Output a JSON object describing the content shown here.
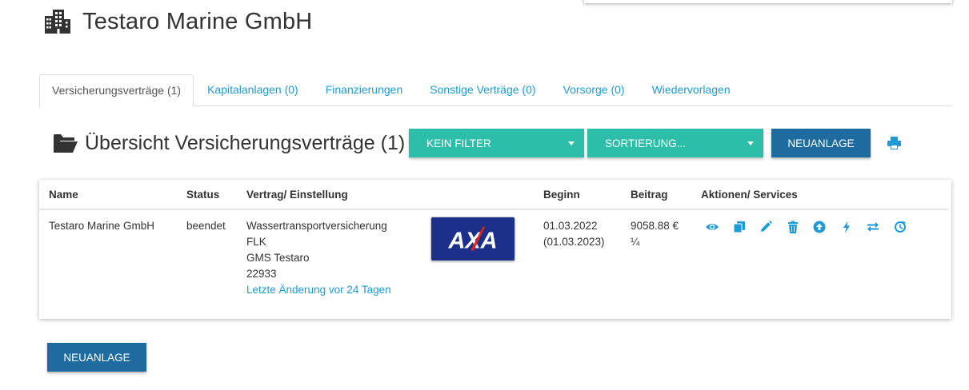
{
  "company_name": "Testaro Marine GmbH",
  "tabs": [
    {
      "label": "Versicherungsverträge (1)",
      "active": true
    },
    {
      "label": "Kapitalanlagen (0)"
    },
    {
      "label": "Finanzierungen"
    },
    {
      "label": "Sonstige Verträge (0)"
    },
    {
      "label": "Vorsorge (0)"
    },
    {
      "label": "Wiedervorlagen"
    }
  ],
  "section_title": "Übersicht Versicherungsverträge (1)",
  "toolbar": {
    "filter_label": "KEIN FILTER",
    "sort_label": "SORTIERUNG...",
    "new_label": "NEUANLAGE"
  },
  "table": {
    "headers": [
      "Name",
      "Status",
      "Vertrag/ Einstellung",
      "Beginn",
      "Beitrag",
      "Aktionen/ Services"
    ],
    "rows": [
      {
        "name": "Testaro Marine GmbH",
        "status": "beendet",
        "contract_lines": [
          "Wassertransportversicherung",
          "FLK",
          "GMS Testaro",
          "22933"
        ],
        "last_change": "Letzte Änderung vor 24 Tagen",
        "insurer_logo": "AXA",
        "begin": "01.03.2022",
        "begin_sub": "(01.03.2023)",
        "amount": "9058.88 €",
        "amount_sub": "¼"
      }
    ]
  },
  "actions": [
    "eye-icon",
    "copy-icon",
    "edit-icon",
    "trash-icon",
    "upload-icon",
    "bolt-icon",
    "swap-icon",
    "refresh-icon"
  ],
  "footer_new_label": "NEUANLAGE",
  "colors": {
    "teal": "#2dbea9",
    "blue": "#1e6b9f",
    "link": "#1e9bd7",
    "axa_blue": "#1c2f8a",
    "axa_red": "#e2231a"
  }
}
